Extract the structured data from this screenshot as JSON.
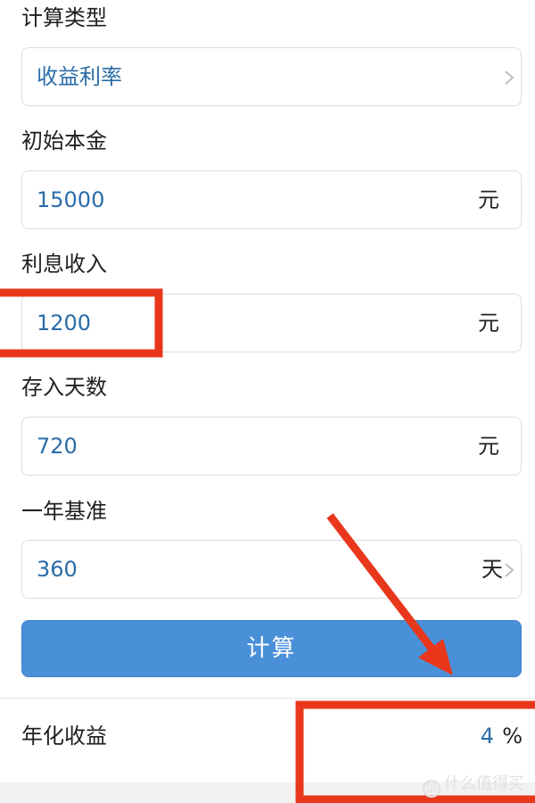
{
  "form": {
    "calc_type": {
      "label": "计算类型",
      "value": "收益利率"
    },
    "principal": {
      "label": "初始本金",
      "value": "15000",
      "unit": "元"
    },
    "interest": {
      "label": "利息收入",
      "value": "1200",
      "unit": "元"
    },
    "days": {
      "label": "存入天数",
      "value": "720",
      "unit": "元"
    },
    "year_basis": {
      "label": "一年基准",
      "value": "360",
      "unit": "天"
    }
  },
  "calculate_button": {
    "label": "计算"
  },
  "result": {
    "label": "年化收益",
    "value": "4",
    "unit": "%"
  },
  "watermark": {
    "icon": "值",
    "text": "什么值得买"
  },
  "colors": {
    "value_text": "#2b6ca8",
    "button_bg": "#4a90d9",
    "annotation_red": "#e8371b"
  },
  "icons": {
    "chevron": "chevron-right-icon"
  }
}
